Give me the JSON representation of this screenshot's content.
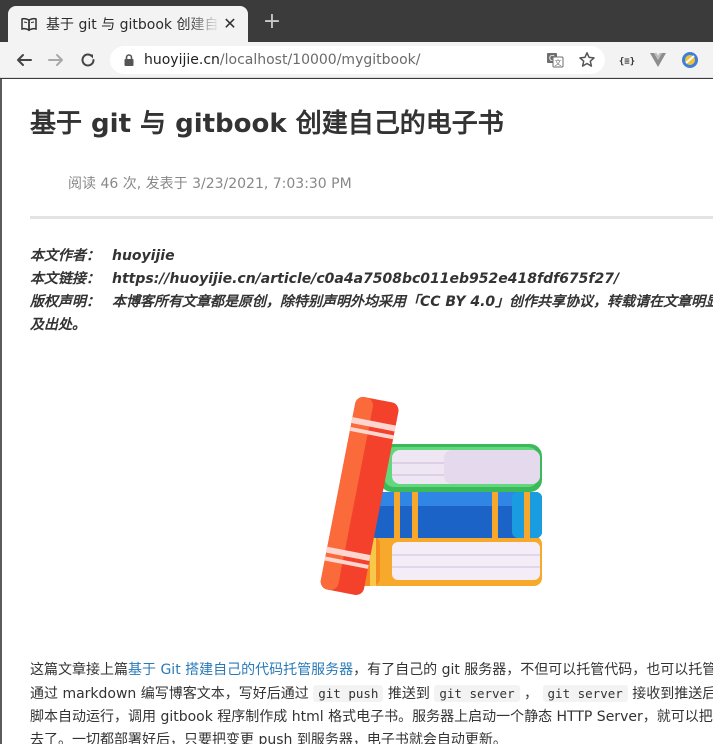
{
  "browser": {
    "tab": {
      "title": "基于 git 与 gitbook 创建自己的电子书"
    },
    "omnibox": {
      "url_host": "huoyijie.cn",
      "url_path": "/localhost/10000/mygitbook/"
    }
  },
  "article": {
    "title": "基于 git 与 gitbook 创建自己的电子书",
    "meta": "阅读 46 次, 发表于 3/23/2021, 7:03:30 PM",
    "copyright": {
      "author_label": "本文作者：",
      "author": "huoyijie",
      "link_label": "本文链接：",
      "link": "https://huoyijie.cn/article/c0a4a7508bc011eb952e418fdf675f27/",
      "statement_label": "版权声明：",
      "statement_line1": "本博客所有文章都是原创，除特别声明外均采用「CC BY 4.0」创作共享协议，转载请在文章明显位置标明作者",
      "statement_line2": "及出处。"
    },
    "body": {
      "l1_pre": "这篇文章接上篇",
      "l1_link": "基于 Git 搭建自己的代码托管服务器",
      "l1_post": "，有了自己的 git 服务器，不但可以托管代码，也可以托管博客文本。",
      "l2_pre": "通过 markdown 编写博客文本，写好后通过 ",
      "l2_code1": "git push",
      "l2_mid1": " 推送到 ",
      "l2_code2": "git server",
      "l2_mid2": " ， ",
      "l2_code3": "git server",
      "l2_post": " 接收到推送后会触发钩子",
      "l3": "脚本自动运行，调用 gitbook 程序制作成 html 格式电子书。服务器上启动一个静态 HTTP Server，就可以把电子书发布出",
      "l4": "去了。一切都部署好后，只要把变更 push 到服务器，电子书就会自动更新。"
    }
  }
}
